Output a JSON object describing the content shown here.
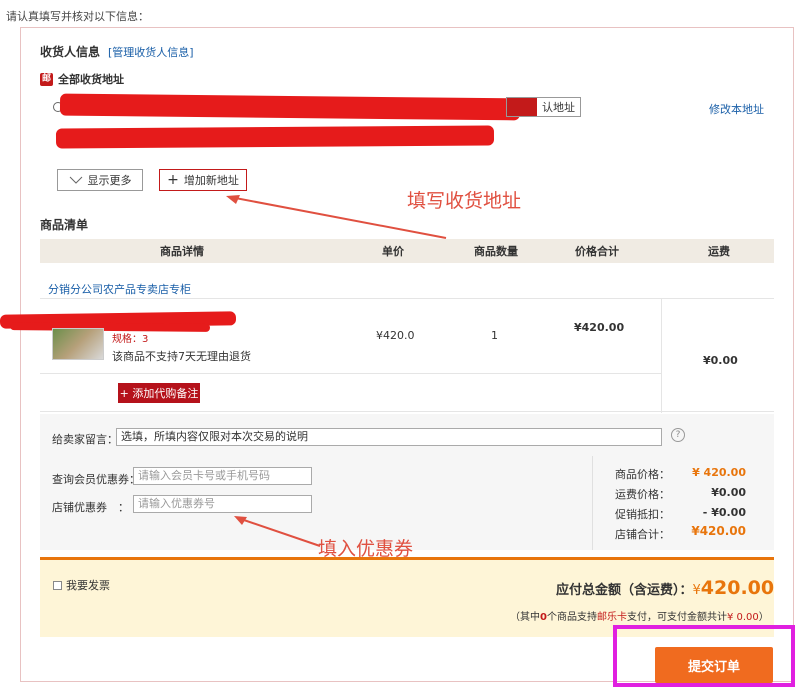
{
  "intro_text": "请认真填写并核对以下信息：",
  "receiver": {
    "section_title": "收货人信息",
    "manage_link": "[管理收货人信息]",
    "all_addresses_label": "全部收货地址",
    "post_icon": "邮",
    "default_button_label": "认地址",
    "edit_address_link": "修改本地址",
    "show_more_label": "显示更多",
    "add_address_label": "增加新地址"
  },
  "annotations": {
    "fill_address": "填写收货地址",
    "fill_coupon": "填入优惠券"
  },
  "product_list": {
    "section_title": "商品清单",
    "columns": [
      "商品详情",
      "单价",
      "商品数量",
      "价格合计",
      "运费"
    ],
    "shop_name": "分销分公司农产品专卖店专柜",
    "items": [
      {
        "spec_prefix": "规格：3",
        "return_policy": "该商品不支持7天无理由退货",
        "unit_price": "¥420.0",
        "quantity": "1",
        "subtotal": "¥420.00",
        "shipping": "¥0.00"
      }
    ],
    "add_note_button": "+ 添加代购备注"
  },
  "seller_note": {
    "label": "给卖家留言：",
    "value": "选填，所填内容仅限对本次交易的说明",
    "help_icon": "?"
  },
  "coupons": {
    "member_label": "查询会员优惠券：",
    "member_placeholder": "请输入会员卡号或手机号码",
    "store_label": "店铺优惠券　：",
    "store_placeholder": "请输入优惠券号"
  },
  "summary": {
    "rows": [
      {
        "label": "商品价格：",
        "value": "¥ 420.00",
        "color": "#e8750c"
      },
      {
        "label": "运费价格：",
        "value": "¥0.00",
        "color": "#333333"
      },
      {
        "label": "促销抵扣：",
        "value": "- ¥0.00",
        "color": "#333333"
      },
      {
        "label": "店铺合计：",
        "value": "¥420.00",
        "color": "#e8750c"
      }
    ]
  },
  "total": {
    "invoice_label": "我要发票",
    "total_label": "应付总金额（含运费）：",
    "currency": "¥",
    "amount": "420.00",
    "note_prefix": "（其中",
    "note_count": "0",
    "note_mid": "个商品支持",
    "note_brand": "邮乐卡",
    "note_suffix": "支付，可支付金额共计",
    "note_amount": "¥ 0.00",
    "note_end": "）"
  },
  "submit_button": "提交订单",
  "colors": {
    "brand_red": "#b5121b",
    "accent_orange": "#e8750c",
    "submit_orange": "#f06b1f",
    "link_blue": "#1a5fa8",
    "annotation_red": "#e05040",
    "highlight_magenta": "#e020e0"
  }
}
